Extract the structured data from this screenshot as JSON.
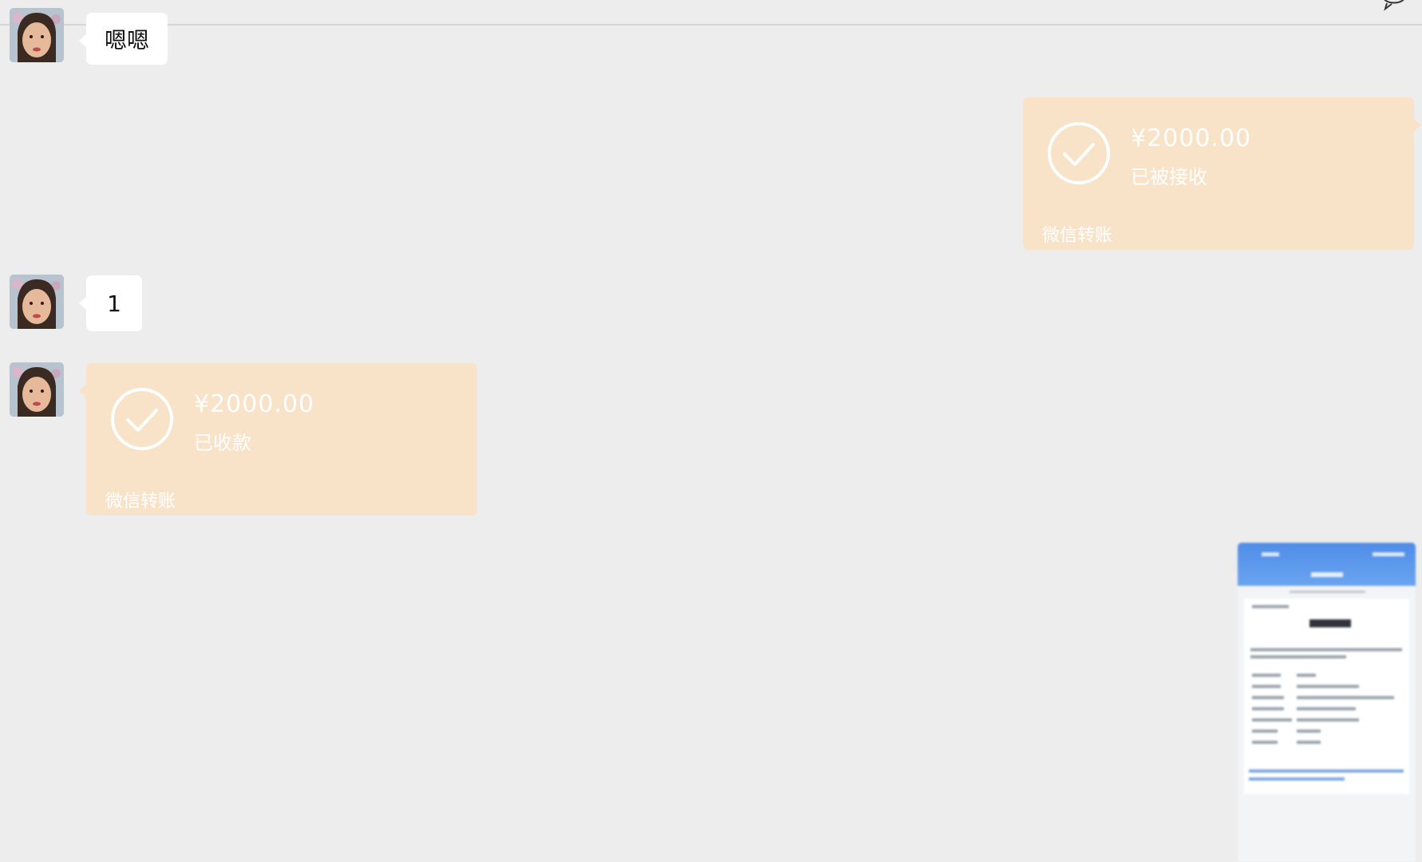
{
  "topbar": {
    "icon": "chat-bubble-icon"
  },
  "messages": {
    "m1": {
      "text": "嗯嗯"
    },
    "m2": {
      "amount": "¥2000.00",
      "status": "已被接收",
      "label": "微信转账"
    },
    "m3": {
      "text": "1"
    },
    "m4": {
      "amount": "¥2000.00",
      "status": "已收款",
      "label": "微信转账"
    }
  },
  "colors": {
    "background": "#ededed",
    "bubble": "#ffffff",
    "transfer": "#f8e3c8",
    "thumbnail_header": "#4f8de8"
  }
}
